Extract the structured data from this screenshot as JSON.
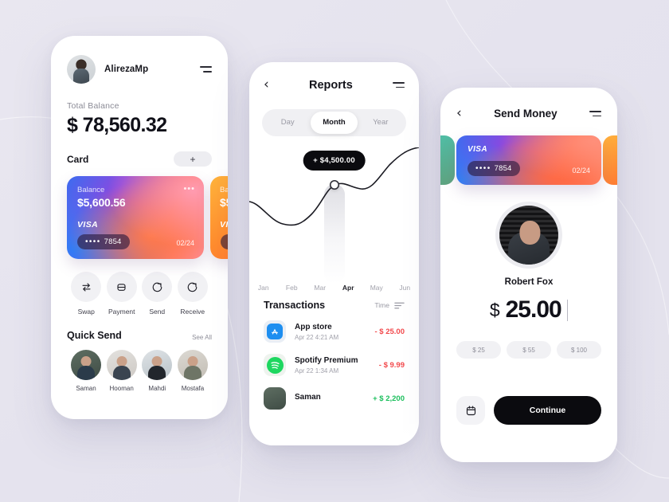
{
  "theme": {
    "background": "#e6e4ef",
    "accent_dark": "#0b0b0f",
    "negative": "#f2484b",
    "positive": "#1bbf5c"
  },
  "screen1": {
    "user_name": "AlirezaMp",
    "menu_icon": "hamburger-icon",
    "total_balance_label": "Total Balance",
    "total_balance_value": "$ 78,560.32",
    "card_section_label": "Card",
    "add_card_label": "+",
    "cards": [
      {
        "balance_label": "Balance",
        "balance_value": "$5,600.56",
        "brand": "VISA",
        "mask": "••••",
        "last4": "7854",
        "expiry": "02/24",
        "more_icon": "more-dots-icon"
      },
      {
        "balance_label": "Balance",
        "balance_value": "$5",
        "brand": "VISA",
        "mask": "••••",
        "last4": "",
        "expiry": ""
      }
    ],
    "actions": [
      {
        "label": "Swap",
        "icon": "swap-icon"
      },
      {
        "label": "Payment",
        "icon": "payment-card-icon"
      },
      {
        "label": "Send",
        "icon": "send-arrow-icon"
      },
      {
        "label": "Receive",
        "icon": "receive-arrow-icon"
      }
    ],
    "quick_send_label": "Quick Send",
    "see_all_label": "See All",
    "contacts": [
      {
        "name": "Saman"
      },
      {
        "name": "Hooman"
      },
      {
        "name": "Mahdi"
      },
      {
        "name": "Mostafa"
      }
    ]
  },
  "screen2": {
    "back_icon": "chevron-left-icon",
    "title": "Reports",
    "menu_icon": "hamburger-icon",
    "segments": [
      {
        "label": "Day",
        "active": false
      },
      {
        "label": "Month",
        "active": true
      },
      {
        "label": "Year",
        "active": false
      }
    ],
    "tooltip": "+ $4,500.00",
    "transactions_label": "Transactions",
    "sort_label": "Time",
    "sort_icon": "sort-icon",
    "transactions": [
      {
        "name": "App store",
        "date": "Apr 22 4:21 AM",
        "amount": "- $ 25.00",
        "direction": "negative",
        "icon": "appstore-icon"
      },
      {
        "name": "Spotify Premium",
        "date": "Apr 22 1:34 AM",
        "amount": "- $ 9.99",
        "direction": "negative",
        "icon": "spotify-icon"
      },
      {
        "name": "Saman",
        "date": "",
        "amount": "+ $ 2,200",
        "direction": "positive",
        "icon": "person-avatar-icon"
      }
    ]
  },
  "chart_data": {
    "type": "line",
    "title": "Reports",
    "categories": [
      "Jan",
      "Feb",
      "Mar",
      "Apr",
      "May",
      "Jun"
    ],
    "values": [
      3200,
      2100,
      2400,
      4500,
      4300,
      6200
    ],
    "highlight_index": 3,
    "highlight_label": "+ $4,500.00",
    "xlabel": "",
    "ylabel": "",
    "grid": false,
    "legend": "none",
    "tick_labels": [
      "Jan",
      "Feb",
      "Mar",
      "Apr",
      "May",
      "Jun"
    ]
  },
  "screen3": {
    "back_icon": "chevron-left-icon",
    "title": "Send Money",
    "menu_icon": "hamburger-icon",
    "card": {
      "brand": "VISA",
      "mask": "••••",
      "last4": "7854",
      "expiry": "02/24"
    },
    "recipient_name": "Robert Fox",
    "currency_symbol": "$",
    "amount_value": "25.00",
    "quick_amounts": [
      {
        "label": "$ 25"
      },
      {
        "label": "$ 55"
      },
      {
        "label": "$ 100"
      }
    ],
    "calendar_icon": "calendar-icon",
    "continue_label": "Continue"
  }
}
